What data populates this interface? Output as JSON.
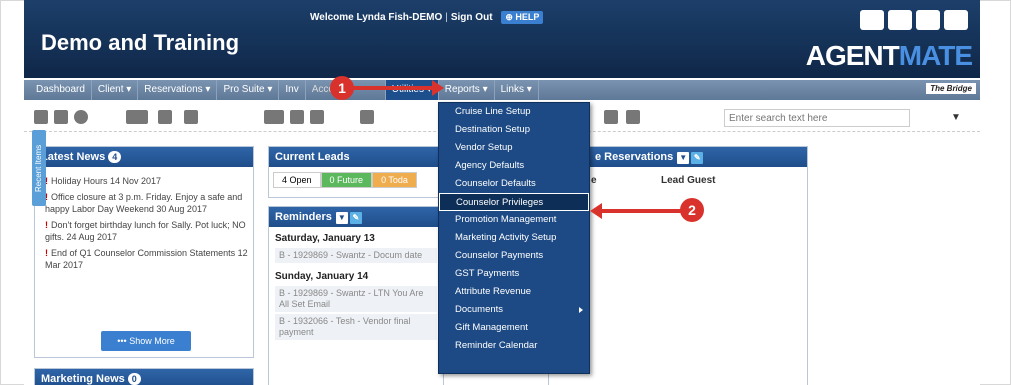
{
  "header": {
    "brand": "Demo and Training",
    "welcome": "Welcome Lynda Fish-DEMO",
    "sign_out": "Sign Out",
    "help": "HELP",
    "logo_agent": "AGENT",
    "logo_mate": "MATE"
  },
  "nav": {
    "items": [
      {
        "label": "Dashboard"
      },
      {
        "label": "Client ▾"
      },
      {
        "label": "Reservations ▾"
      },
      {
        "label": "Pro Suite ▾"
      },
      {
        "label": "Inv"
      },
      {
        "label": "Accounts"
      },
      {
        "label": "Utilities ▾"
      },
      {
        "label": "Reports ▾"
      },
      {
        "label": "Links ▾"
      }
    ],
    "bridge": "The Bridge"
  },
  "search": {
    "placeholder": "Enter search text here"
  },
  "recent_tab": "Recent Items",
  "latest_news": {
    "title": "Latest News",
    "count": "4",
    "items": [
      "Holiday Hours 14 Nov 2017",
      "Office closure at 3 p.m. Friday. Enjoy a safe and happy Labor Day Weekend 30 Aug 2017",
      "Don't forget birthday lunch for Sally. Pot luck; NO gifts. 24 Aug 2017",
      "End of Q1 Counselor Commission Statements 12 Mar 2017"
    ],
    "show_more": "••• Show More"
  },
  "marketing_news": {
    "title": "Marketing News",
    "count": "0"
  },
  "current_leads": {
    "title": "Current Leads",
    "tabs": [
      "4 Open",
      "0 Future",
      "0 Toda"
    ]
  },
  "reminders": {
    "title": "Reminders",
    "day1": "Saturday, January 13",
    "day1_item": "B - 1929869 - Swantz - Docum date",
    "day2": "Sunday, January 14",
    "day2_item1": "B - 1929869 - Swantz - LTN You Are All Set Email",
    "day2_item2": "B - 1932066 - Tesh - Vendor final payment"
  },
  "reservations": {
    "title": "e Reservations",
    "col1": "e",
    "col2": "Lead Guest"
  },
  "utilities_menu": [
    "Cruise Line Setup",
    "Destination Setup",
    "Vendor Setup",
    "Agency Defaults",
    "Counselor Defaults",
    "Counselor Privileges",
    "Promotion Management",
    "Marketing Activity Setup",
    "Counselor Payments",
    "GST Payments",
    "Attribute Revenue",
    "Documents",
    "Gift Management",
    "Reminder Calendar"
  ],
  "callouts": [
    "1",
    "2"
  ],
  "colors": {
    "accent": "#1d4a84",
    "arrow": "#d9322c",
    "header": "#1c3f6a"
  }
}
